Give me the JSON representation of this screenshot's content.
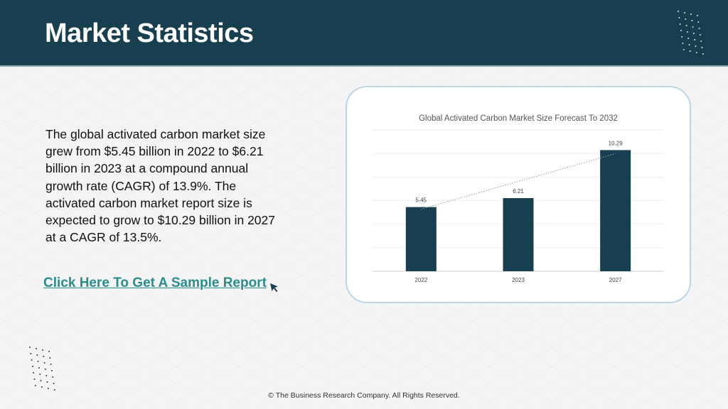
{
  "header": {
    "title": "Market Statistics"
  },
  "body": {
    "paragraph": "The global activated carbon market size grew from $5.45 billion in 2022 to $6.21 billion in 2023 at a compound annual growth rate (CAGR) of 13.9%. The activated carbon market report size is expected to grow to $10.29 billion in 2027 at a CAGR of 13.5%.",
    "cta_label": "Click Here To Get A Sample Report"
  },
  "icons": {
    "cursor": "cursor-arrow-icon",
    "decor": "dot-pattern-icon"
  },
  "colors": {
    "header_bg": "#173f4f",
    "bar": "#173f4f",
    "link": "#2a8d8d",
    "card_border": "#bcd6e6"
  },
  "chart_data": {
    "type": "bar",
    "title": "Global Activated Carbon Market Size Forecast To 2032",
    "categories": [
      "2022",
      "2023",
      "2027"
    ],
    "values": [
      5.45,
      6.21,
      10.29
    ],
    "data_labels": [
      "5.45",
      "6.21",
      "10.29"
    ],
    "xlabel": "",
    "ylabel": "",
    "ylim": [
      0,
      12
    ],
    "grid": true,
    "trendline": true,
    "legend": "none"
  },
  "footer": {
    "copyright": "© The Business Research Company. All Rights Reserved."
  }
}
